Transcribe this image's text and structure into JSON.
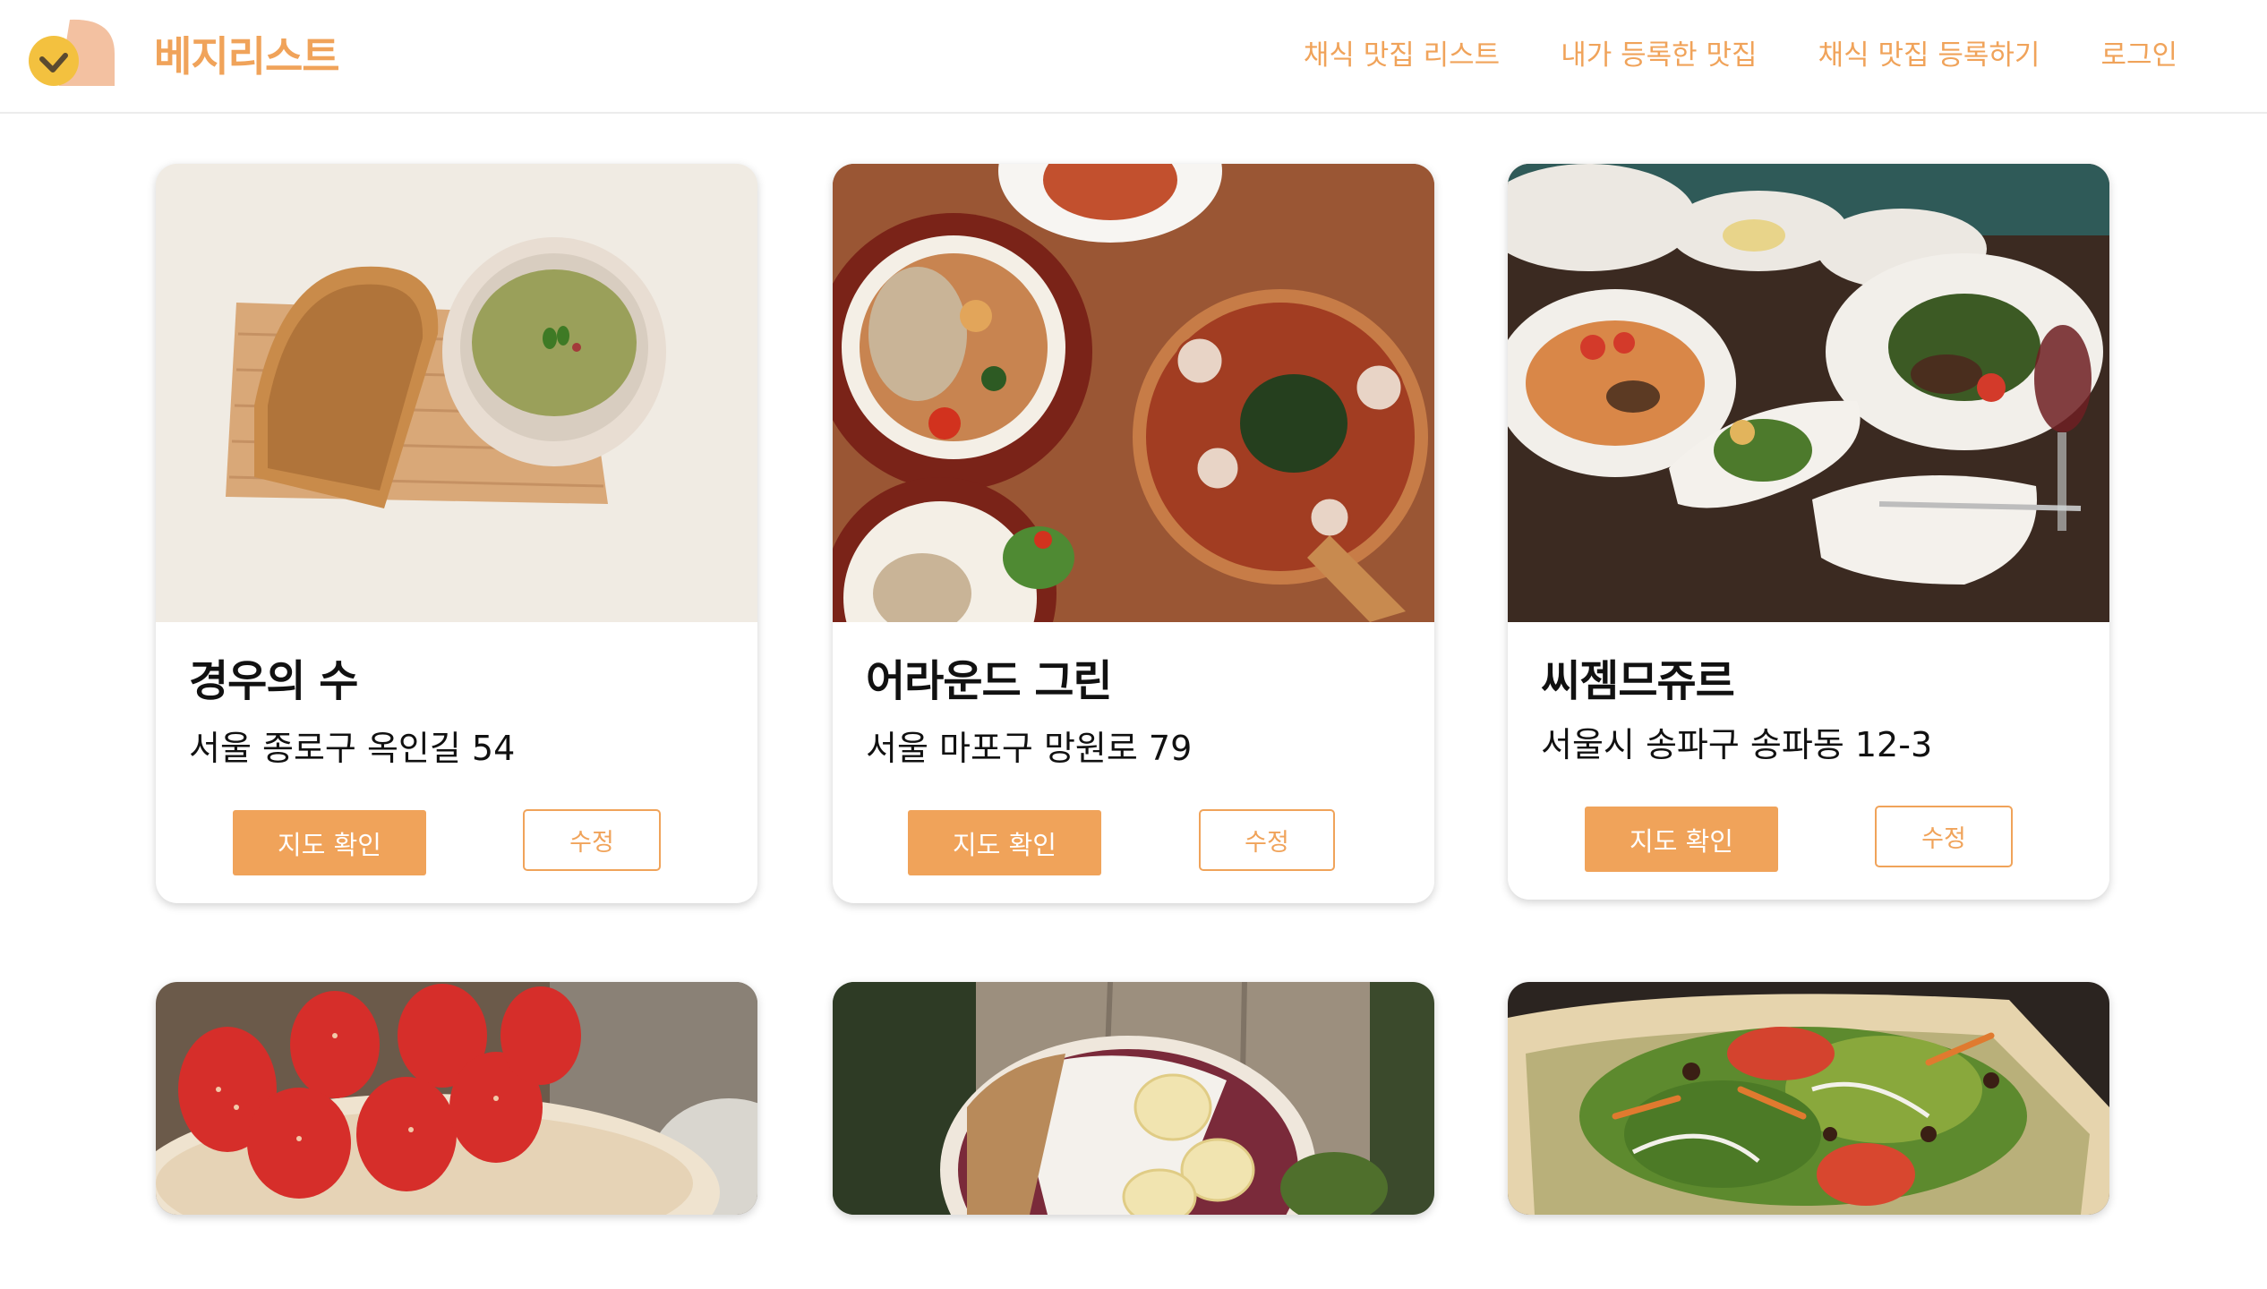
{
  "brand": {
    "name": "베지리스트"
  },
  "nav": {
    "items": [
      {
        "label": "채식 맛집 리스트"
      },
      {
        "label": "내가 등록한 맛집"
      },
      {
        "label": "채식 맛집 등록하기"
      },
      {
        "label": "로그인"
      }
    ]
  },
  "colors": {
    "accent": "#f0a35a",
    "logo_yellow": "#f3c13f",
    "logo_peach": "#f3c1a1"
  },
  "restaurants": [
    {
      "name": "경우의 수",
      "address": "서울 종로구 옥인길 54",
      "map_label": "지도 확인",
      "edit_label": "수정",
      "image": "toast-and-pea-soup-photo"
    },
    {
      "name": "어라운드 그린",
      "address": "서울 마포구 망원로 79",
      "map_label": "지도 확인",
      "edit_label": "수정",
      "image": "curry-and-lotus-pizza-photo"
    },
    {
      "name": "씨젬므쥬르",
      "address": "서울시 송파구 송파동 12-3",
      "map_label": "지도 확인",
      "edit_label": "수정",
      "image": "pasta-and-salad-table-photo"
    },
    {
      "image": "strawberry-cake-photo"
    },
    {
      "image": "acai-bowl-photo"
    },
    {
      "image": "salad-pizza-photo"
    }
  ]
}
